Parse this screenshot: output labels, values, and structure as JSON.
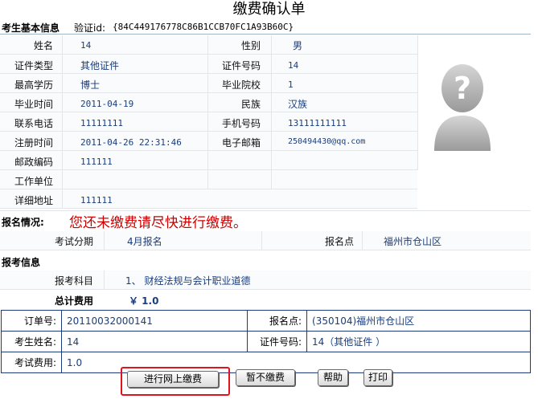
{
  "page": {
    "title": "缴费确认单",
    "basic_section": "考生基本信息",
    "verify_label": "验证id:",
    "verify_value": "{84C449176778C86B1CCB70FC1A93B60C}"
  },
  "basic": {
    "name_label": "姓名",
    "name": "14",
    "gender_label": "性别",
    "gender": "男",
    "idtype_label": "证件类型",
    "idtype": "其他证件",
    "idno_label": "证件号码",
    "idno": "14",
    "edu_label": "最高学历",
    "edu": "博士",
    "school_label": "毕业院校",
    "school": "1",
    "gradtime_label": "毕业时间",
    "gradtime": "2011-04-19",
    "nation_label": "民族",
    "nation": "汉族",
    "phone_label": "联系电话",
    "phone": "11111111",
    "mobile_label": "手机号码",
    "mobile": "13111111111",
    "regtime_label": "注册时间",
    "regtime": "2011-04-26 22:31:46",
    "email_label": "电子邮箱",
    "email": "250494430@qq.com",
    "zip_label": "邮政编码",
    "zip": "111111",
    "work_label": "工作单位",
    "work": "",
    "addr_label": "详细地址",
    "addr": "111111"
  },
  "status": {
    "label": "报名情况:",
    "message": "您还未缴费请尽快进行缴费。",
    "period_label": "考试分期",
    "period": "4月报名",
    "site_label": "报名点",
    "site": "福州市仓山区"
  },
  "exam": {
    "section": "报考信息",
    "subject_label": "报考科目",
    "subject": "1、 财经法规与会计职业道德",
    "total_label": "总计费用",
    "total": "￥ 1.0"
  },
  "order": {
    "no_label": "订单号:",
    "no": "20110032000141",
    "site_label": "报名点:",
    "site": "(350104)福州市仓山区",
    "name_label": "考生姓名:",
    "name": "14",
    "idno_label": "证件号码:",
    "idno": "14（其他证件 ）",
    "fee_label": "考试费用:",
    "fee": "1.0"
  },
  "buttons": {
    "pay_online": "进行网上缴费",
    "pay_later": "暂不缴费",
    "help": "帮助",
    "print": "打印"
  },
  "colors": {
    "highlight": "#e0141e",
    "warning": "#cc0000",
    "value": "#1a3d7c"
  }
}
